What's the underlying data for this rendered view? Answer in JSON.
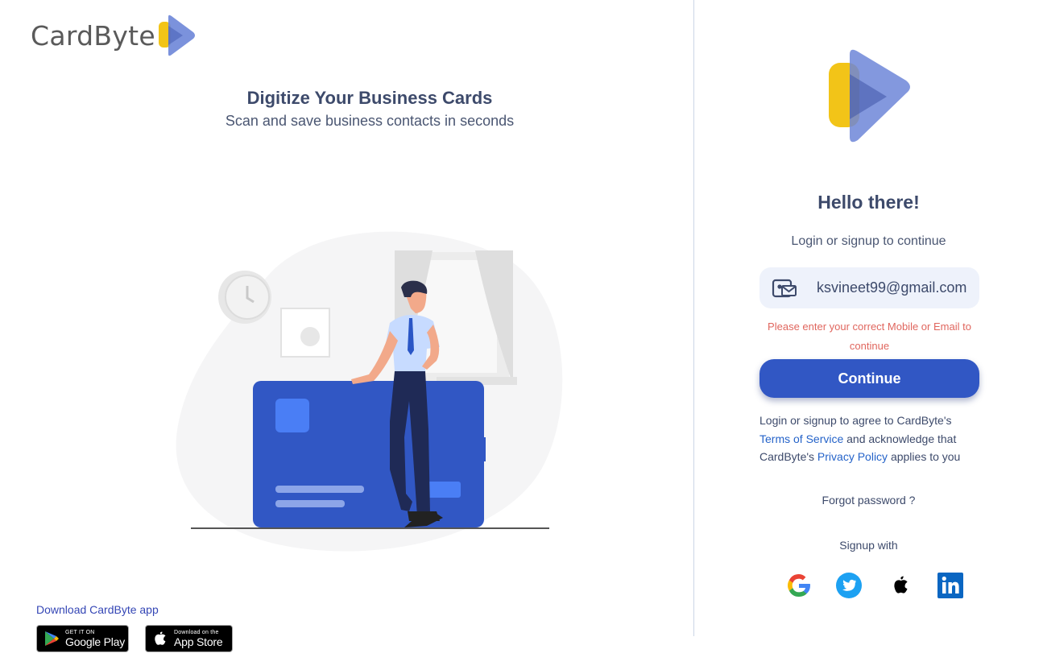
{
  "brand": {
    "name_bold": "Card",
    "name_light": "Byte"
  },
  "hero": {
    "title": "Digitize Your Business Cards",
    "subtitle": "Scan and save business contacts in seconds"
  },
  "download": {
    "label": "Download CardByte app",
    "google_play": {
      "small": "GET IT ON",
      "big": "Google Play"
    },
    "app_store": {
      "small": "Download on the",
      "big": "App Store"
    }
  },
  "login": {
    "greeting": "Hello there!",
    "subtitle": "Login or signup to continue",
    "email_value": "ksvineet99@gmail.com",
    "error": "Please enter your correct Mobile or Email to continue",
    "continue_label": "Continue",
    "terms": {
      "part1": "Login or signup to agree to CardByte's ",
      "tos_link": "Terms of Service",
      "part2": " and acknowledge that CardByte's ",
      "privacy_link": "Privacy Policy",
      "part3": " applies to you"
    },
    "forgot": "Forgot password ?",
    "signup_with": "Signup with",
    "social": [
      "google-icon",
      "twitter-icon",
      "apple-icon",
      "linkedin-icon"
    ]
  },
  "colors": {
    "primary": "#3157c4",
    "error": "#e0665e",
    "link": "#2563c9",
    "logo_yellow": "#f2c418",
    "logo_blue": "#6d86d8"
  }
}
